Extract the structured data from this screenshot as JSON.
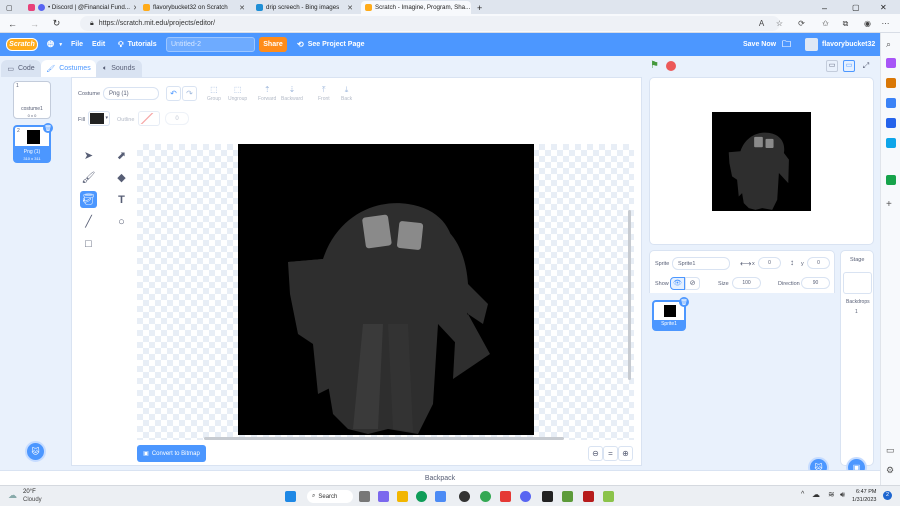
{
  "browser": {
    "tabs": [
      {
        "label": "• Discord | @Financial Fund...",
        "active": false
      },
      {
        "label": "flavorybucket32 on Scratch",
        "active": false
      },
      {
        "label": "drip screech - Bing images",
        "active": false
      },
      {
        "label": "Scratch - Imagine, Program, Sha...",
        "active": true
      }
    ],
    "url": "https://scratch.mit.edu/projects/editor/"
  },
  "menubar": {
    "logo": "Scratch",
    "file": "File",
    "edit": "Edit",
    "tutorials": "Tutorials",
    "project_title": "Untitled-2",
    "share": "Share",
    "see_project_page": "See Project Page",
    "save_now": "Save Now",
    "username": "flavorybucket32"
  },
  "editor_tabs": {
    "code": "Code",
    "costumes": "Costumes",
    "sounds": "Sounds"
  },
  "costumes": [
    {
      "num": "1",
      "name": "costume1",
      "size": "0 x 0"
    },
    {
      "num": "2",
      "name": "Png (1)",
      "size": "310 x 311"
    }
  ],
  "paint": {
    "costume_label": "Costume",
    "costume_name": "Png (1)",
    "group": "Group",
    "ungroup": "Ungroup",
    "forward": "Forward",
    "backward": "Backward",
    "front": "Front",
    "back": "Back",
    "fill_label": "Fill",
    "outline_label": "Outline",
    "outline_width": "0",
    "convert_button": "Convert to Bitmap",
    "zoom_reset": "="
  },
  "sprite_info": {
    "sprite_label": "Sprite",
    "sprite_name": "Sprite1",
    "x_label": "x",
    "x_value": "0",
    "y_label": "y",
    "y_value": "0",
    "show_label": "Show",
    "size_label": "Size",
    "size_value": "100",
    "direction_label": "Direction",
    "direction_value": "90"
  },
  "sprites": [
    {
      "name": "Sprite1"
    }
  ],
  "stage_pane": {
    "title": "Stage",
    "backdrops_label": "Backdrops",
    "backdrops_count": "1"
  },
  "backpack": "Backpack",
  "taskbar": {
    "weather_temp": "20°F",
    "weather_desc": "Cloudy",
    "search": "Search",
    "time": "6:47 PM",
    "date": "1/31/2023",
    "notif_count": "2"
  },
  "colors": {
    "scratch_blue": "#4c97ff",
    "share_orange": "#ff8c1a",
    "fill_color": "#222222"
  }
}
